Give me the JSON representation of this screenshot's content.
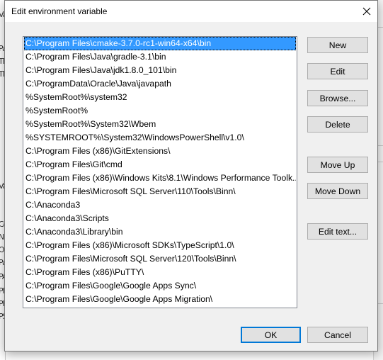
{
  "dialog": {
    "title": "Edit environment variable"
  },
  "background_fragments": [
    "Va",
    "Pa",
    "TE",
    "TM",
    "Va",
    "Co",
    "NU",
    "OS",
    "Pa",
    "PA",
    "PR",
    "PR",
    "PS"
  ],
  "path_entries": [
    "C:\\Program Files\\cmake-3.7.0-rc1-win64-x64\\bin",
    "C:\\Program Files\\Java\\gradle-3.1\\bin",
    "C:\\Program Files\\Java\\jdk1.8.0_101\\bin",
    "C:\\ProgramData\\Oracle\\Java\\javapath",
    "%SystemRoot%\\system32",
    "%SystemRoot%",
    "%SystemRoot%\\System32\\Wbem",
    "%SYSTEMROOT%\\System32\\WindowsPowerShell\\v1.0\\",
    "C:\\Program Files (x86)\\GitExtensions\\",
    "C:\\Program Files\\Git\\cmd",
    "C:\\Program Files (x86)\\Windows Kits\\8.1\\Windows Performance Toolk...",
    "C:\\Program Files\\Microsoft SQL Server\\110\\Tools\\Binn\\",
    "C:\\Anaconda3",
    "C:\\Anaconda3\\Scripts",
    "C:\\Anaconda3\\Library\\bin",
    "C:\\Program Files (x86)\\Microsoft SDKs\\TypeScript\\1.0\\",
    "C:\\Program Files\\Microsoft SQL Server\\120\\Tools\\Binn\\",
    "C:\\Program Files (x86)\\PuTTY\\",
    "C:\\Program Files\\Google\\Google Apps Sync\\",
    "C:\\Program Files\\Google\\Google Apps Migration\\"
  ],
  "selected_index": 0,
  "buttons": {
    "new": "New",
    "edit": "Edit",
    "browse": "Browse...",
    "delete": "Delete",
    "move_up": "Move Up",
    "move_down": "Move Down",
    "edit_text": "Edit text...",
    "ok": "OK",
    "cancel": "Cancel"
  },
  "colors": {
    "selection": "#3399ff",
    "ok_border": "#0078d7"
  },
  "icons": {
    "close": "close-icon"
  }
}
